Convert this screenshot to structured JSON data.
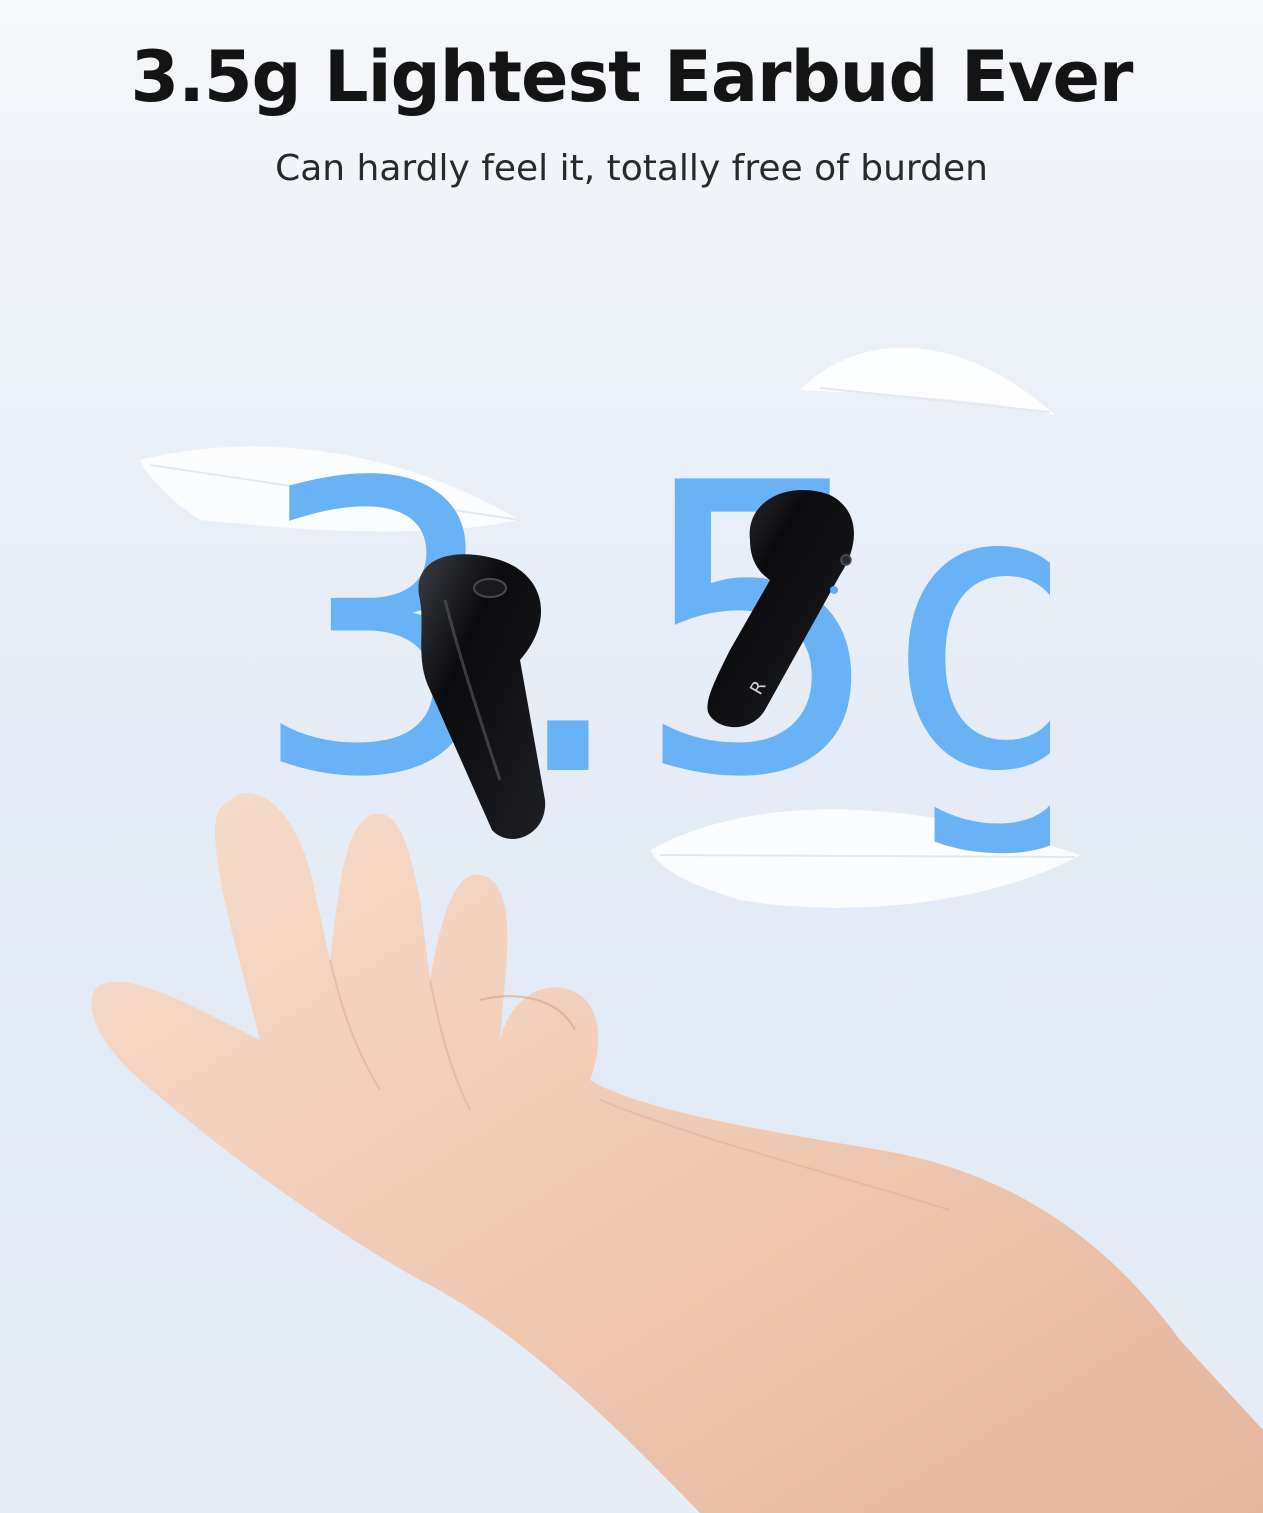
{
  "headline": "3.5g Lightest Earbud Ever",
  "subheadline": "Can hardly feel it, totally free of burden",
  "weight_graphic": "3.5g",
  "earbud_side_mark": "R",
  "colors": {
    "headline": "#141414",
    "weight_graphic": "#69b2f5",
    "earbud": "#0d0d0f",
    "skin": "#f1cdb7"
  },
  "icons": [
    "feather-icon",
    "left-earbud-icon",
    "right-earbud-icon",
    "hand-icon"
  ]
}
